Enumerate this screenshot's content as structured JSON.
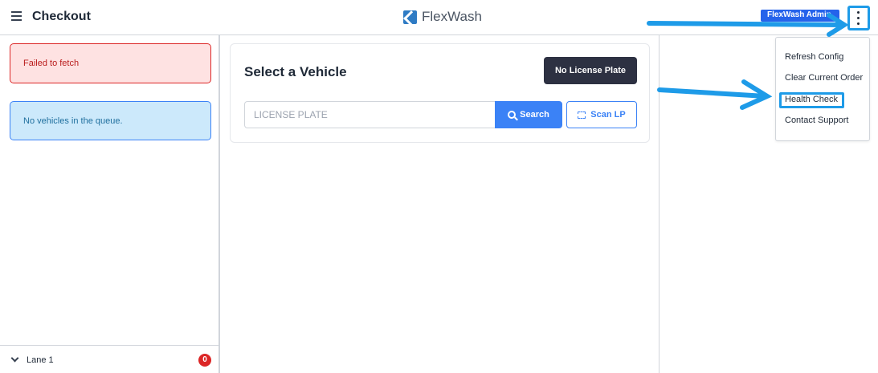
{
  "header": {
    "title": "Checkout",
    "brand_name": "FlexWash",
    "user_badge": "FlexWash Admin",
    "menu_icon": "hamburger-icon",
    "more_icon": "kebab-vertical-icon"
  },
  "sidebar": {
    "error_message": "Failed to fetch",
    "info_message": "No vehicles in the queue.",
    "lane_label": "Lane 1",
    "lane_count": "0"
  },
  "main": {
    "card_title": "Select a Vehicle",
    "no_plate_label": "No License Plate",
    "plate_placeholder": "LICENSE PLATE",
    "search_label": "Search",
    "scan_label": "Scan LP"
  },
  "menu": {
    "items": [
      "Refresh Config",
      "Clear Current Order",
      "Health Check",
      "Contact Support"
    ]
  },
  "colors": {
    "accent": "#3b82f6",
    "annotation": "#1e9be8",
    "error": "#dc2626",
    "dark_button": "#2d3142"
  }
}
